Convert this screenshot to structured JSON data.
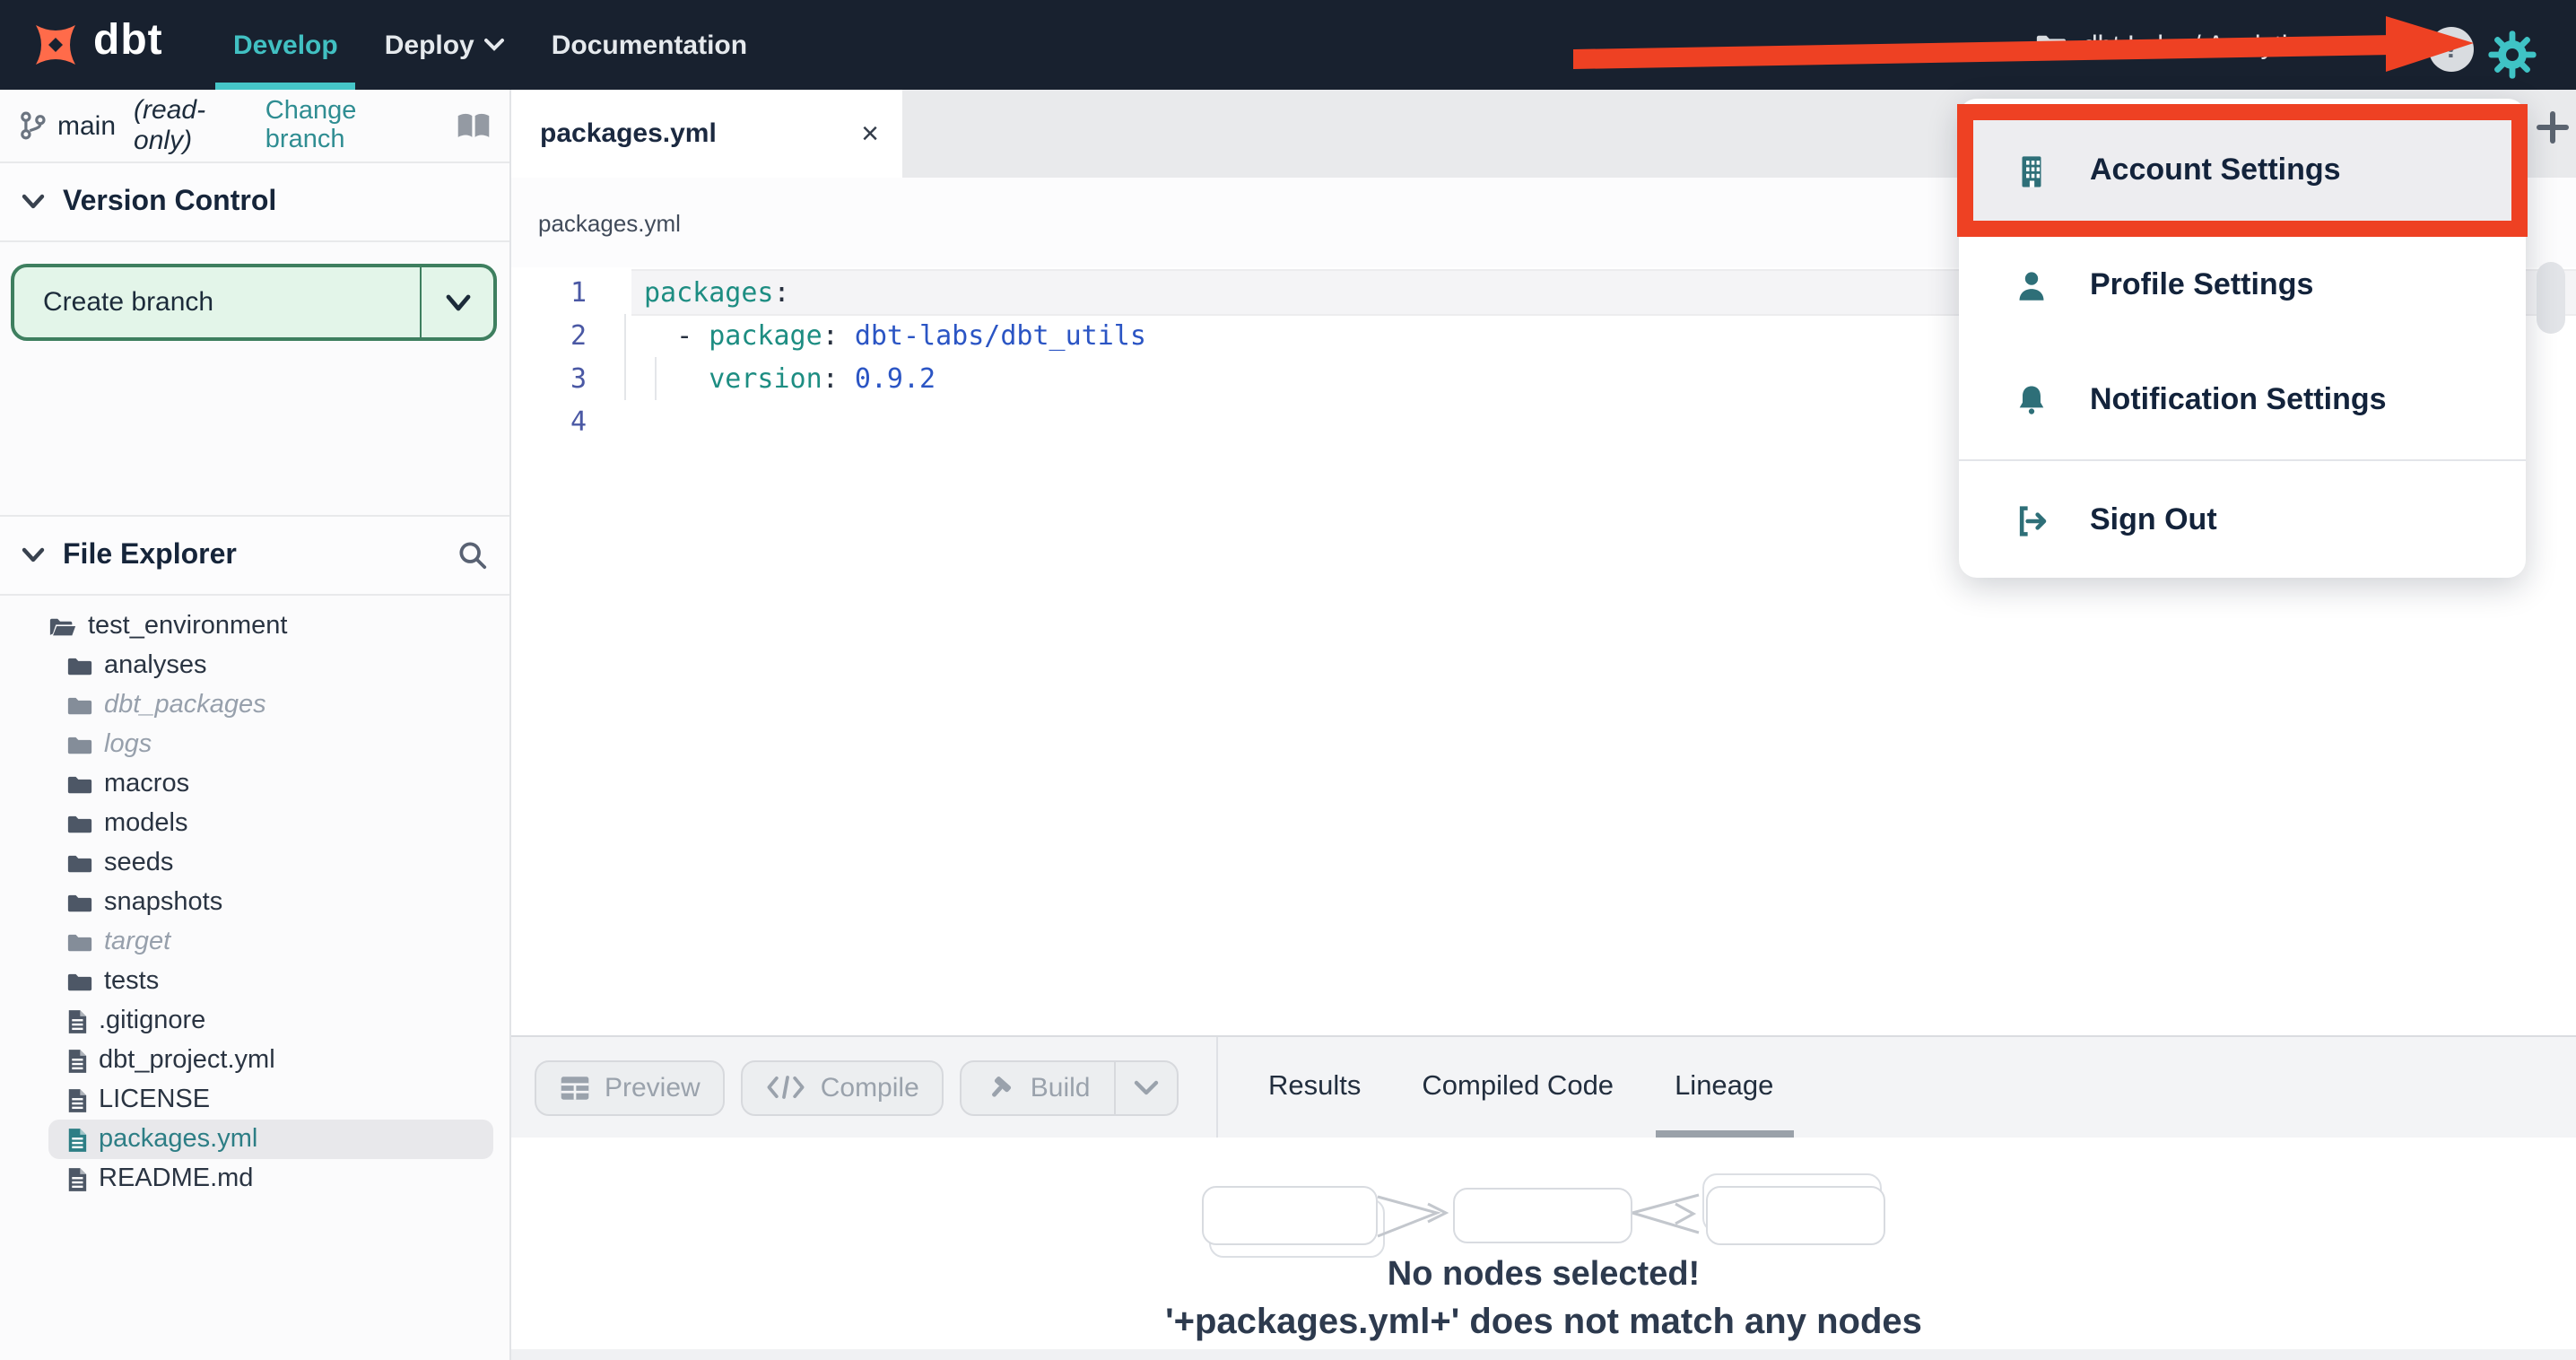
{
  "navbar": {
    "brand": "dbt",
    "menu": [
      {
        "label": "Develop",
        "active": true
      },
      {
        "label": "Deploy",
        "has_caret": true
      },
      {
        "label": "Documentation"
      }
    ],
    "project_context": "dbt Labs / Analytics",
    "help_label": "?"
  },
  "account_menu": {
    "items": [
      {
        "label": "Account Settings",
        "icon": "building-icon",
        "highlighted": true
      },
      {
        "label": "Profile Settings",
        "icon": "user-icon"
      },
      {
        "label": "Notification Settings",
        "icon": "bell-icon"
      },
      {
        "label": "Sign Out",
        "icon": "sign-out-icon",
        "divider_before": true
      }
    ]
  },
  "sidebar": {
    "branch": {
      "name": "main",
      "readonly_label": "(read-only)",
      "change_branch_label": "Change branch"
    },
    "version_control": {
      "title": "Version Control",
      "create_branch_label": "Create branch"
    },
    "file_explorer": {
      "title": "File Explorer",
      "tree": [
        {
          "name": "test_environment",
          "type": "folder-open",
          "level": 0
        },
        {
          "name": "analyses",
          "type": "folder",
          "level": 1
        },
        {
          "name": "dbt_packages",
          "type": "folder",
          "level": 1,
          "muted": true
        },
        {
          "name": "logs",
          "type": "folder",
          "level": 1,
          "muted": true
        },
        {
          "name": "macros",
          "type": "folder",
          "level": 1
        },
        {
          "name": "models",
          "type": "folder",
          "level": 1
        },
        {
          "name": "seeds",
          "type": "folder",
          "level": 1
        },
        {
          "name": "snapshots",
          "type": "folder",
          "level": 1
        },
        {
          "name": "target",
          "type": "folder",
          "level": 1,
          "muted": true
        },
        {
          "name": "tests",
          "type": "folder",
          "level": 1
        },
        {
          "name": ".gitignore",
          "type": "file",
          "level": 1
        },
        {
          "name": "dbt_project.yml",
          "type": "file",
          "level": 1
        },
        {
          "name": "LICENSE",
          "type": "file",
          "level": 1
        },
        {
          "name": "packages.yml",
          "type": "file",
          "level": 1,
          "selected": true
        },
        {
          "name": "README.md",
          "type": "file",
          "level": 1
        }
      ]
    }
  },
  "editor": {
    "tab_title": "packages.yml",
    "close_glyph": "×",
    "breadcrumb": "packages.yml",
    "code_lines": [
      {
        "num": "1",
        "active": true,
        "tokens": [
          {
            "c": "key",
            "t": "packages"
          },
          {
            "c": "plain",
            "t": ":"
          }
        ]
      },
      {
        "num": "2",
        "tokens": [
          {
            "c": "plain",
            "t": "  - "
          },
          {
            "c": "key",
            "t": "package"
          },
          {
            "c": "plain",
            "t": ": "
          },
          {
            "c": "val",
            "t": "dbt-labs/dbt_utils"
          }
        ]
      },
      {
        "num": "3",
        "tokens": [
          {
            "c": "plain",
            "t": "    "
          },
          {
            "c": "key",
            "t": "version"
          },
          {
            "c": "plain",
            "t": ": "
          },
          {
            "c": "val",
            "t": "0.9.2"
          }
        ]
      },
      {
        "num": "4",
        "tokens": []
      }
    ]
  },
  "toolbar": {
    "buttons": [
      {
        "label": "Preview",
        "icon": "table-icon"
      },
      {
        "label": "Compile",
        "icon": "code-icon"
      },
      {
        "label": "Build",
        "icon": "hammer-icon",
        "split": true
      }
    ]
  },
  "result_tabs": [
    {
      "label": "Results"
    },
    {
      "label": "Compiled Code"
    },
    {
      "label": "Lineage",
      "active": true
    }
  ],
  "lineage": {
    "empty_title": "No nodes selected!",
    "empty_subtitle": "'+packages.yml+' does not match any nodes"
  },
  "colors": {
    "navbar_bg": "#18212f",
    "accent_teal": "#41c0c2",
    "link_teal": "#2f8d92",
    "annotation_red": "#ee4123",
    "create_branch_green_bg": "#e3f5e9",
    "create_branch_green_border": "#3e7f5f",
    "code_key": "#1d8d82",
    "code_value": "#2b55c4",
    "line_number": "#4a58a4"
  }
}
